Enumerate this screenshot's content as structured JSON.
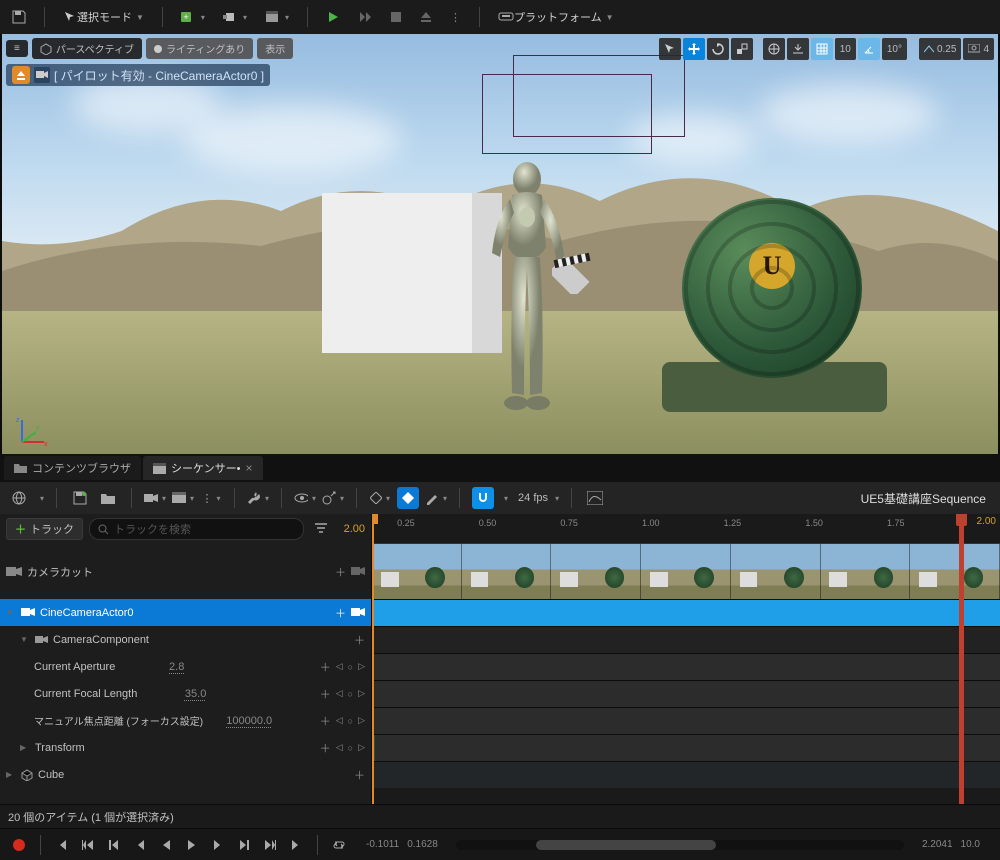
{
  "toolbar": {
    "select_mode": "選択モード",
    "platform": "プラットフォーム"
  },
  "viewport": {
    "perspective": "パースペクティブ",
    "lighting": "ライティングあり",
    "show": "表示",
    "pilot_text": "[ パイロット有効 - CineCameraActor0 ]",
    "grid_val1": "10",
    "grid_val2": "10°",
    "speed": "0.25",
    "cam_count": "4"
  },
  "tabs": {
    "content_browser": "コンテンツブラウザ",
    "sequencer": "シーケンサー•"
  },
  "sequencer": {
    "fps": "24 fps",
    "name": "UE5基礎講座Sequence",
    "track_btn": "トラック",
    "search_placeholder": "トラックを検索",
    "start": "2.00",
    "end": "2.00",
    "ruler": [
      "0.25",
      "0.50",
      "0.75",
      "1.00",
      "1.25",
      "1.50",
      "1.75"
    ],
    "tracks": {
      "camera_cut": "カメラカット",
      "cine_camera": "CineCameraActor0",
      "camera_component": "CameraComponent",
      "aperture": {
        "label": "Current Aperture",
        "value": "2.8"
      },
      "focal": {
        "label": "Current Focal Length",
        "value": "35.0"
      },
      "manual_focus": {
        "label": "マニュアル焦点距離 (フォーカス設定)",
        "value": "100000.0"
      },
      "transform": "Transform",
      "cube": "Cube"
    },
    "status": "20 個のアイテム (1 個が選択済み)",
    "time_left": "-0.1011",
    "time_mid": "0.1628",
    "time_r1": "2.2041",
    "time_r2": "10.0"
  }
}
